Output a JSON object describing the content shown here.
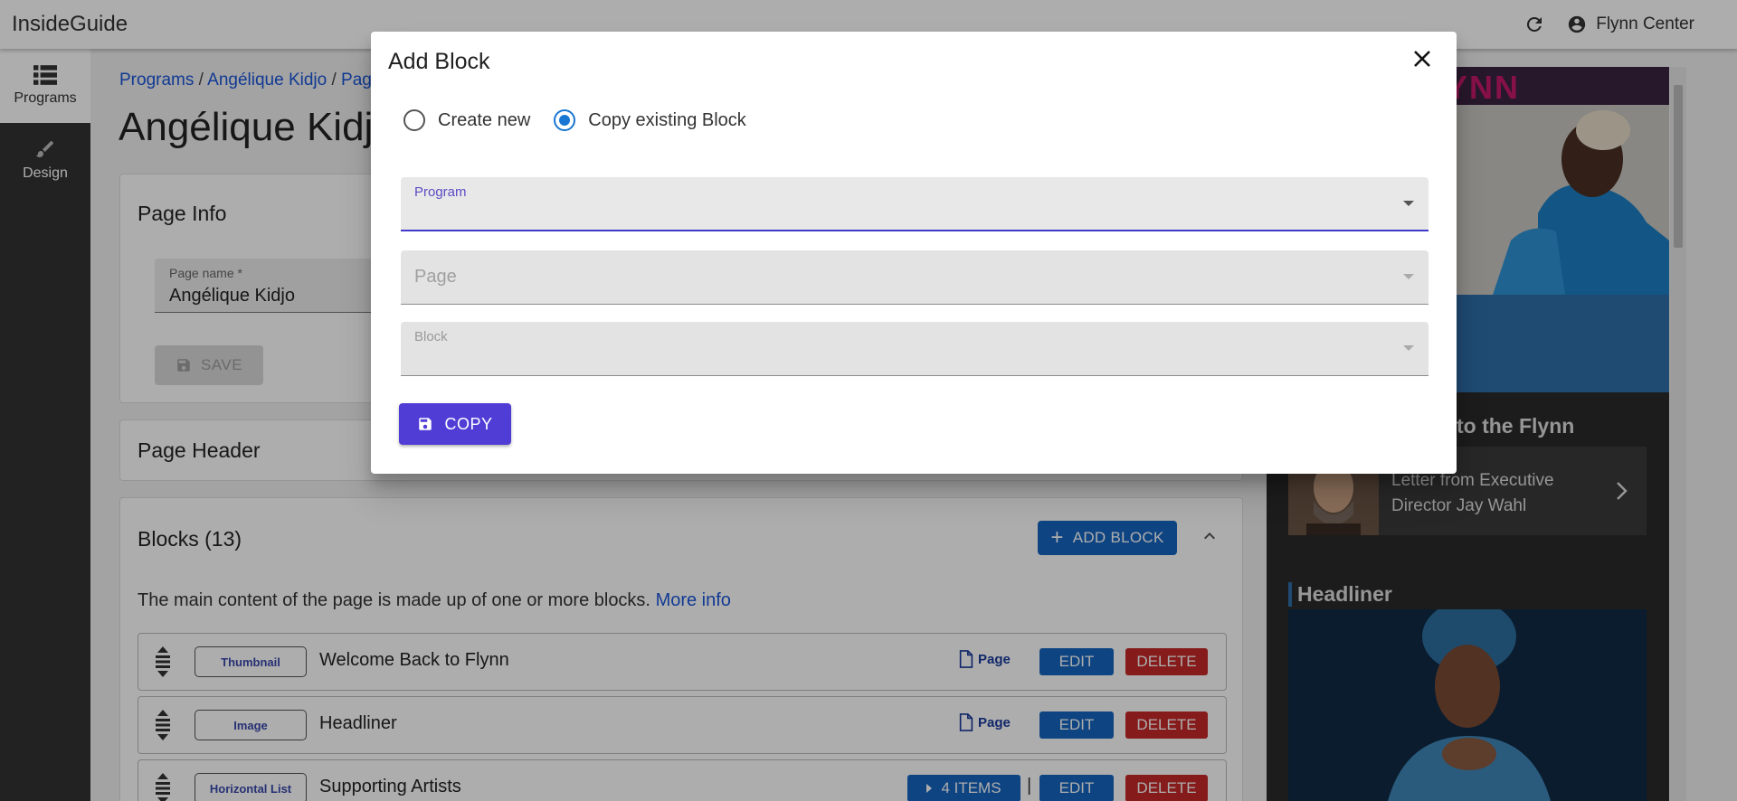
{
  "app": {
    "brand": "InsideGuide",
    "account_name": "Flynn Center"
  },
  "rail": {
    "items": [
      {
        "label": "Programs",
        "icon": "list-icon"
      },
      {
        "label": "Design",
        "icon": "brush-icon"
      }
    ]
  },
  "breadcrumb": {
    "programs": "Programs",
    "sep1": "/",
    "program": "Angélique Kidjo",
    "sep2": "/",
    "pages": "Pag"
  },
  "page_title": "Angélique Kidj",
  "page_info": {
    "title": "Page Info",
    "page_name_label": "Page name *",
    "page_name_value": "Angélique Kidjo",
    "save_label": "SAVE"
  },
  "page_header": {
    "title": "Page Header"
  },
  "blocks": {
    "title": "Blocks (13)",
    "add_label": "ADD BLOCK",
    "description": "The main content of the page is made up of one or more blocks.",
    "more_info": "More info",
    "rows": [
      {
        "tag": "Thumbnail",
        "title": "Welcome Back to Flynn",
        "page_link": "Page",
        "edit": "EDIT",
        "delete": "DELETE"
      },
      {
        "tag": "Image",
        "title": "Headliner",
        "page_link": "Page",
        "edit": "EDIT",
        "delete": "DELETE"
      },
      {
        "tag": "Horizontal List",
        "title": "Supporting Artists",
        "items": "4 ITEMS",
        "sep": "|",
        "edit": "EDIT",
        "delete": "DELETE"
      }
    ]
  },
  "preview": {
    "logo": "YNN",
    "section1": "to the Flynn",
    "letter_text": "Letter from Executive Director Jay Wahl",
    "section2": "Headliner"
  },
  "dialog": {
    "title": "Add Block",
    "radio_create": "Create new",
    "radio_copy": "Copy existing Block",
    "selected_radio": "copy",
    "program_label": "Program",
    "page_label": "Page",
    "block_label": "Block",
    "copy_label": "COPY"
  },
  "colors": {
    "primary": "#1565c0",
    "danger": "#c62828",
    "accent": "#4f3dd6",
    "rail": "#333333"
  }
}
